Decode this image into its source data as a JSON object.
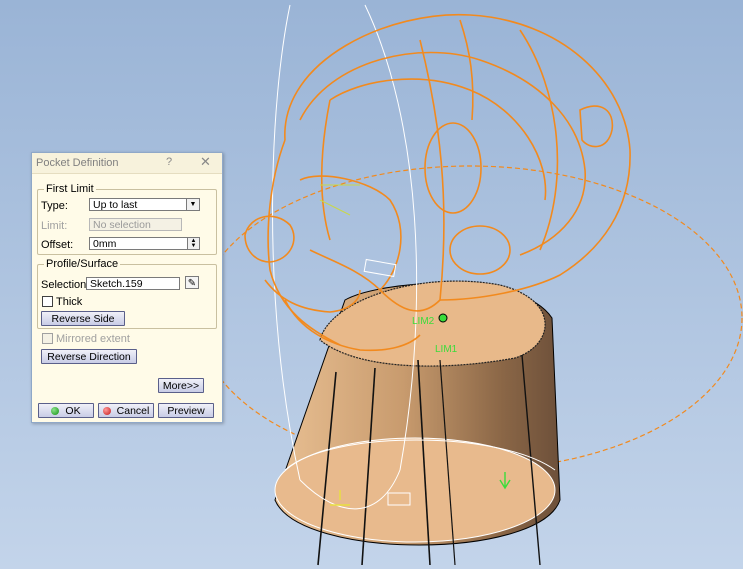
{
  "dialog": {
    "title": "Pocket Definition",
    "help": "?",
    "close": "✕",
    "first_limit": {
      "legend": "First Limit",
      "type_label": "Type:",
      "type_value": "Up to last",
      "limit_label": "Limit:",
      "limit_value": "No selection",
      "offset_label": "Offset:",
      "offset_value": "0mm"
    },
    "profile": {
      "legend": "Profile/Surface",
      "selection_label": "Selection:",
      "selection_value": "Sketch.159",
      "thick_label": "Thick",
      "reverse_side": "Reverse Side"
    },
    "mirrored_extent": "Mirrored extent",
    "reverse_direction": "Reverse Direction",
    "more": "More>>",
    "ok": "OK",
    "cancel": "Cancel",
    "preview": "Preview"
  },
  "viewport": {
    "label_lim2": "LIM2",
    "label_lim1": "LIM1",
    "colors": {
      "background_top": "#9ab4d6",
      "wireframe": "#f28a1e",
      "solid": "#e5b587",
      "limit_label": "#3bdc3b"
    }
  }
}
